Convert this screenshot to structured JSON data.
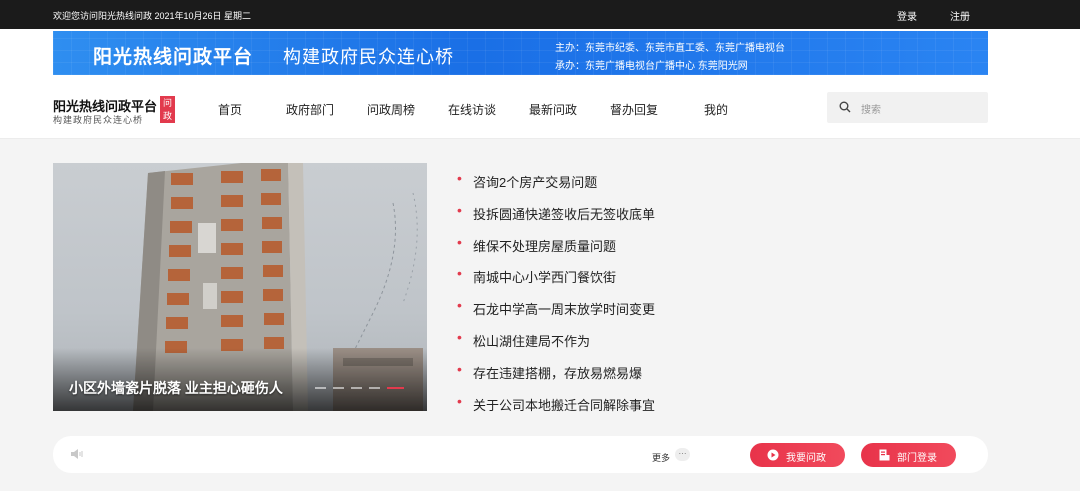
{
  "topbar": {
    "welcome": "欢迎您访问阳光热线问政 2021年10月26日 星期二",
    "login": "登录",
    "register": "注册"
  },
  "banner": {
    "title": "阳光热线问政平台",
    "slogan": "构建政府民众连心桥",
    "host": "主办：东莞市纪委、东莞市直工委、东莞广播电视台",
    "organizer": "承办：东莞广播电视台广播中心 东莞阳光网"
  },
  "logo": {
    "main": "阳光热线问政平台",
    "sub": "构建政府民众连心桥",
    "badge_top": "问",
    "badge_bottom": "政"
  },
  "nav": {
    "items": [
      {
        "label": "首页"
      },
      {
        "label": "政府部门"
      },
      {
        "label": "问政周榜"
      },
      {
        "label": "在线访谈"
      },
      {
        "label": "最新问政"
      },
      {
        "label": "督办回复"
      },
      {
        "label": "我的"
      }
    ]
  },
  "search": {
    "placeholder": "搜索",
    "icon": "search-icon"
  },
  "carousel": {
    "caption": "小区外墙瓷片脱落 业主担心砸伤人",
    "slide_count": 5,
    "active_index": 4
  },
  "news": {
    "items": [
      "咨询2个房产交易问题",
      "投拆圆通快递签收后无签收底单",
      "维保不处理房屋质量问题",
      "南城中心小学西门餐饮街",
      "石龙中学高一周末放学时间变更",
      "松山湖住建局不作为",
      "存在违建搭棚，存放易燃易爆",
      "关于公司本地搬迁合同解除事宜"
    ]
  },
  "bottombar": {
    "more_label": "更多",
    "more_icon": "···",
    "ask_button": "我要问政",
    "dept_login_button": "部门登录"
  },
  "colors": {
    "accent": "#e23a4d",
    "banner_blue": "#1a6fe6",
    "topbar_bg": "#1b1b1b"
  }
}
